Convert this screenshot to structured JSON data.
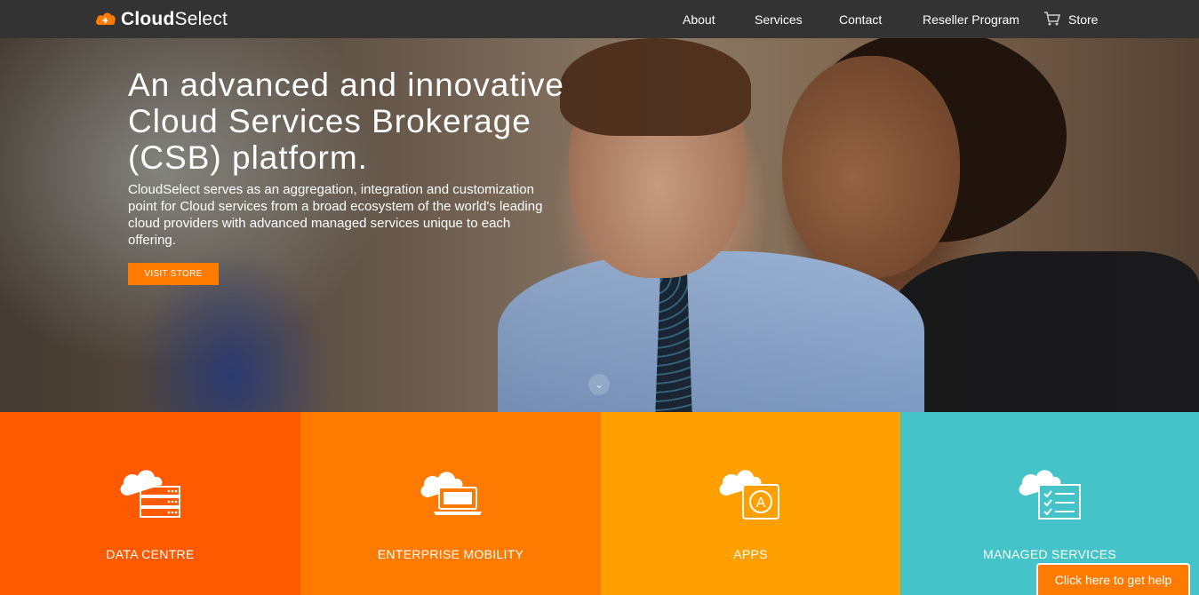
{
  "header": {
    "logo_text_bold": "Cloud",
    "logo_text_rest": "Select",
    "nav": [
      "About",
      "Services",
      "Contact",
      "Reseller Program",
      "Store"
    ]
  },
  "hero": {
    "title": "An advanced and innovative Cloud Services Brokerage (CSB) platform.",
    "description": "CloudSelect serves as an aggregation, integration and customization point for Cloud services from a broad ecosystem of the world's leading cloud providers with advanced managed services unique to each offering.",
    "cta_label": "VISIT STORE",
    "scroll_icon": "chevron-down-icon"
  },
  "tiles": [
    {
      "label": "DATA CENTRE",
      "color": "#ff5a00",
      "icon": "cloud-server-icon"
    },
    {
      "label": "ENTERPRISE MOBILITY",
      "color": "#ff7a00",
      "icon": "cloud-laptop-icon"
    },
    {
      "label": "APPS",
      "color": "#ffa000",
      "icon": "cloud-app-icon"
    },
    {
      "label": "MANAGED SERVICES",
      "color": "#44c4c8",
      "icon": "cloud-checklist-icon"
    }
  ],
  "help": {
    "label": "Click here to get help"
  },
  "colors": {
    "accent": "#ff7a00",
    "header_bg": "#333333"
  }
}
